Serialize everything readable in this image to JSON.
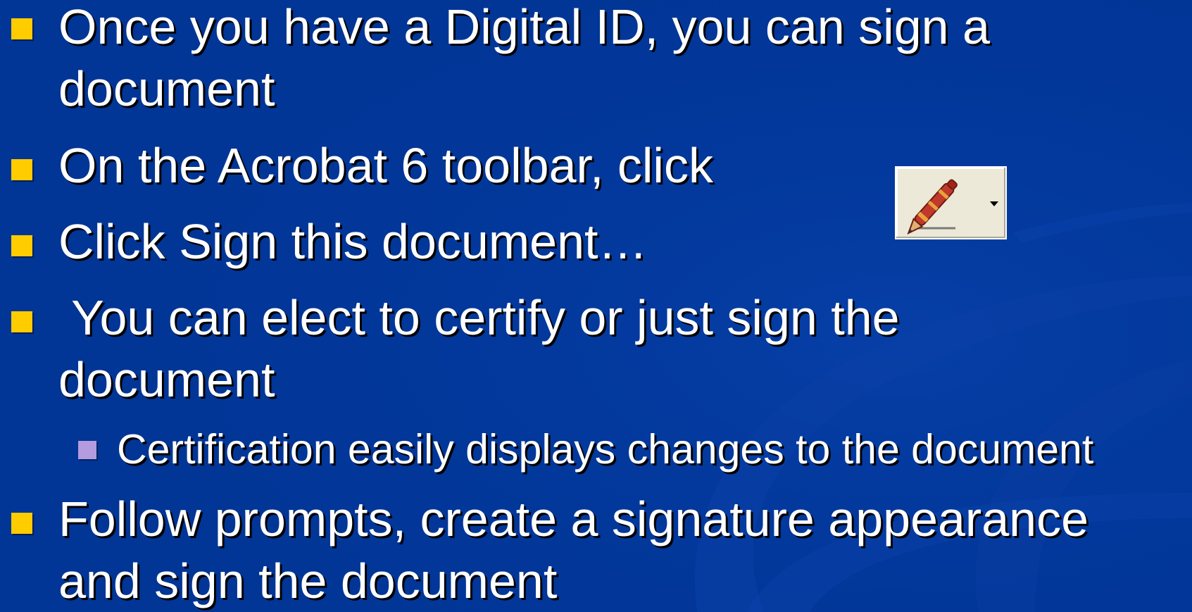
{
  "slide": {
    "bullets": [
      {
        "level": 1,
        "lines": [
          "Once you have a Digital ID, you can sign a",
          "document"
        ]
      },
      {
        "level": 1,
        "lines": [
          "On the Acrobat 6 toolbar, click"
        ]
      },
      {
        "level": 1,
        "lines": [
          "Click Sign this document…"
        ]
      },
      {
        "level": 1,
        "lines": [
          " You can elect to certify or just sign the",
          "document"
        ]
      },
      {
        "level": 2,
        "lines": [
          "Certification easily displays changes to the document"
        ]
      },
      {
        "level": 1,
        "lines": [
          "Follow prompts, create a signature appearance",
          "and sign the document"
        ]
      }
    ],
    "toolbar_button": {
      "icon": "sign-pen-icon",
      "dropdown_icon": "dropdown-arrow-icon"
    }
  },
  "colors": {
    "background": "#013596",
    "bullet_level1": "#ffcc00",
    "bullet_level2": "#b49cde",
    "text": "#ffffff"
  }
}
